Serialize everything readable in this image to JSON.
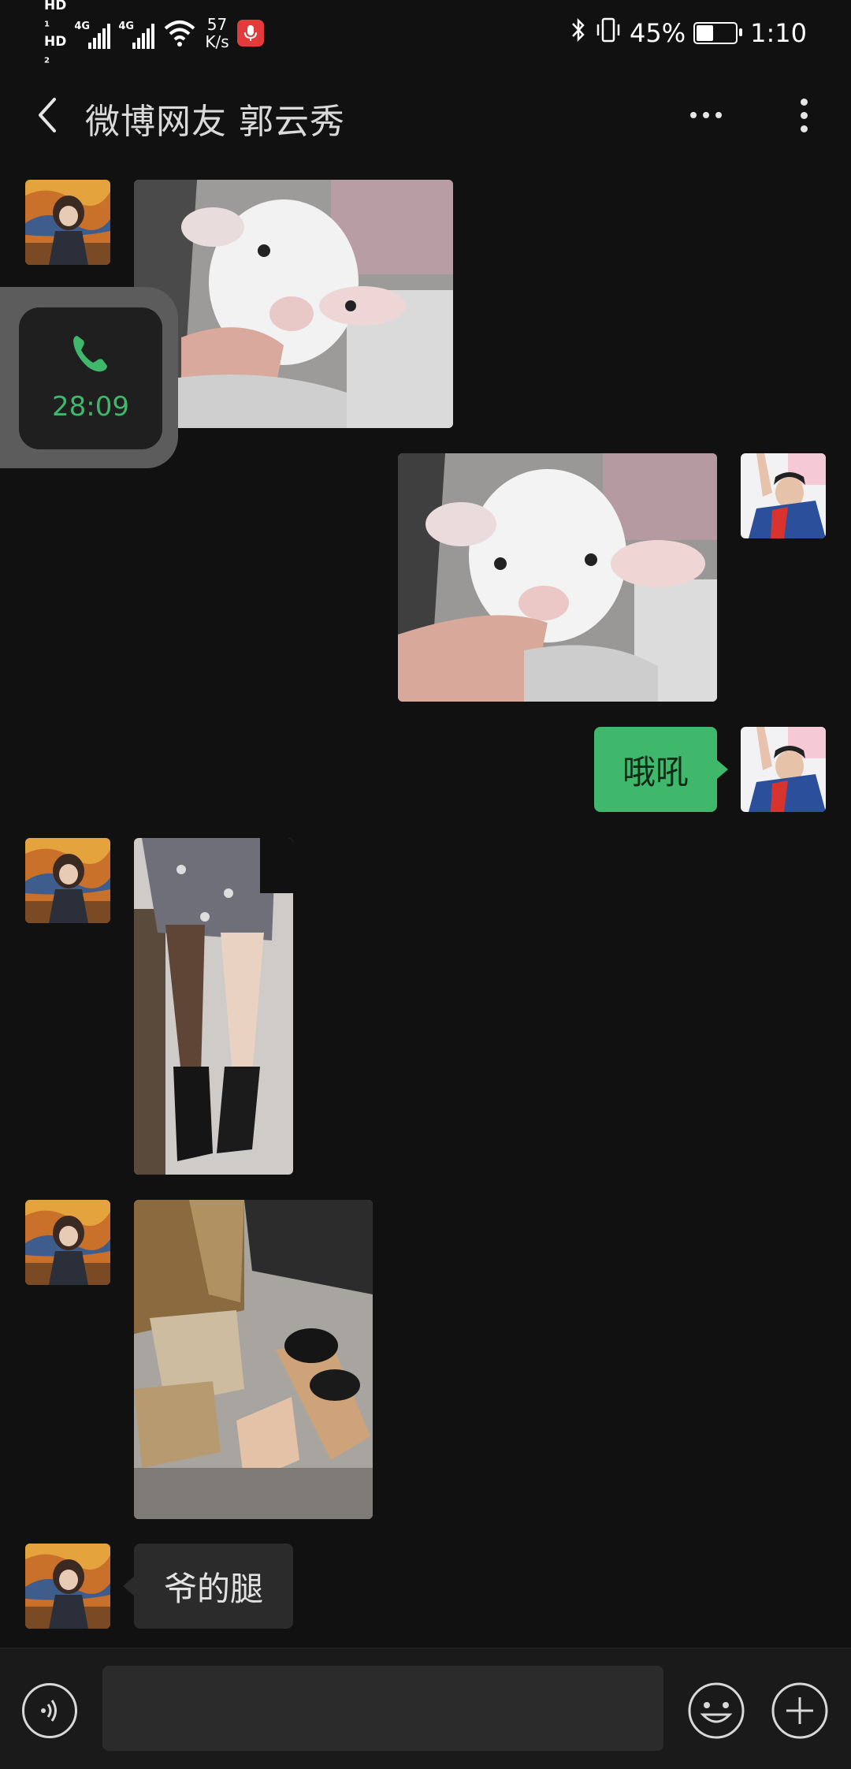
{
  "status_bar": {
    "hd1": "HD",
    "hd1_sub": "1",
    "hd2": "HD",
    "hd2_sub": "2",
    "network1": "4G",
    "network2": "4G",
    "speed_value": "57",
    "speed_unit": "K/s",
    "battery_percent": "45%",
    "time": "1:10",
    "icons": [
      "bluetooth-icon",
      "vibrate-icon",
      "battery-icon",
      "wifi-icon",
      "mic-icon"
    ]
  },
  "header": {
    "title": "微博网友 郭云秀",
    "back_icon": "chevron-left-icon",
    "more_icon": "more-dots-icon",
    "menu_icon": "vertical-menu-icon"
  },
  "call_overlay": {
    "icon": "phone-icon",
    "duration": "28:09",
    "accent": "#3fb86b"
  },
  "messages": [
    {
      "side": "left",
      "type": "image",
      "subject": "white lamb"
    },
    {
      "side": "right",
      "type": "image",
      "subject": "white lamb"
    },
    {
      "side": "right",
      "type": "text",
      "text": "哦吼"
    },
    {
      "side": "left",
      "type": "image",
      "subject": "legs in boots"
    },
    {
      "side": "left",
      "type": "image",
      "subject": "boots on floor"
    },
    {
      "side": "left",
      "type": "text",
      "text": "爷的腿"
    }
  ],
  "input_bar": {
    "voice_icon": "voice-icon",
    "placeholder": "",
    "value": "",
    "emoji_icon": "emoji-icon",
    "plus_icon": "plus-icon"
  },
  "colors": {
    "background": "#111111",
    "sent_bubble": "#3fb86b",
    "received_bubble": "#2b2b2b"
  }
}
